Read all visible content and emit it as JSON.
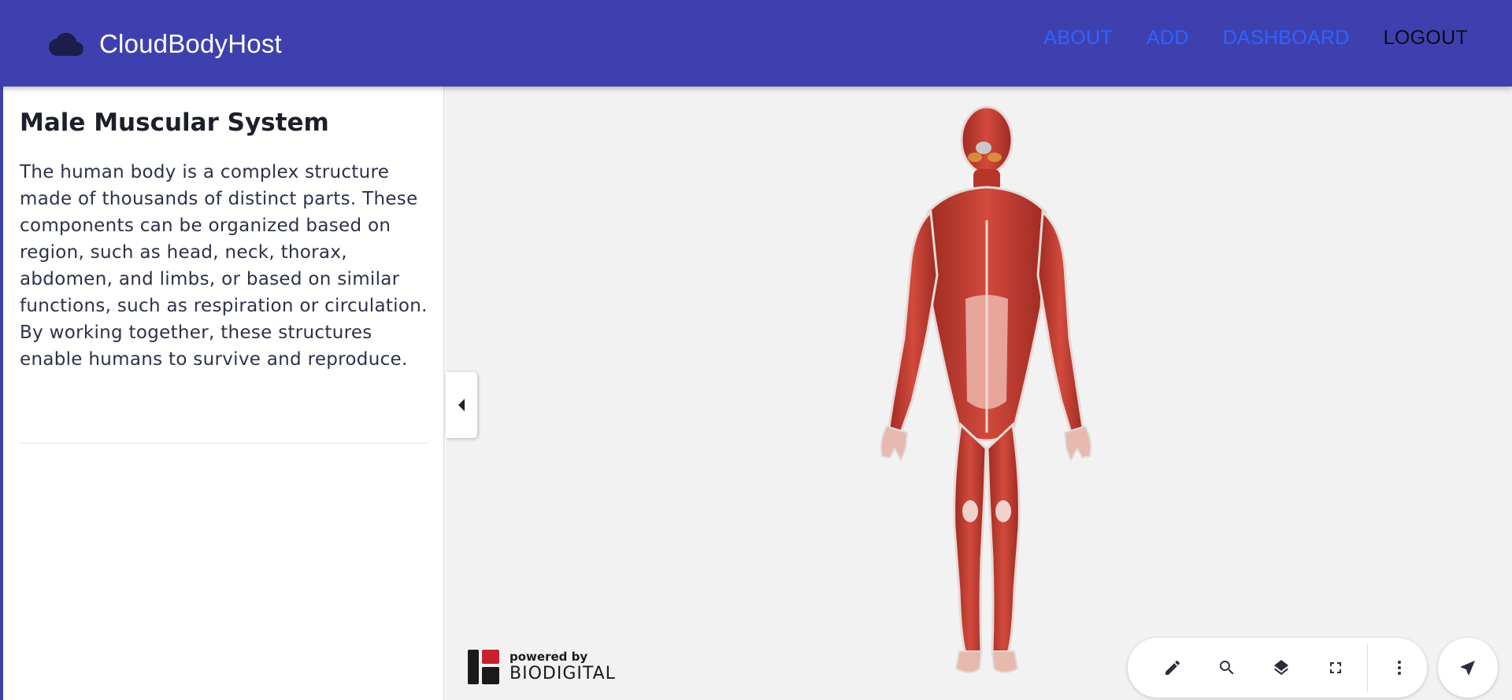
{
  "header": {
    "brand_name": "CloudBodyHost",
    "brand_icon": "cloud-icon",
    "nav": [
      {
        "label": "ABOUT"
      },
      {
        "label": "ADD"
      },
      {
        "label": "DASHBOARD"
      },
      {
        "label": "LOGOUT"
      }
    ]
  },
  "sidebar": {
    "title": "Male Muscular System",
    "description": "The human body is a complex structure made of thousands of distinct parts. These components can be organized based on region, such as head, neck, thorax, abdomen, and limbs, or based on similar functions, such as respiration or circulation. By working together, these structures enable humans to survive and reproduce.",
    "collapse_icon": "caret-left-icon"
  },
  "viewer": {
    "powered_by": "powered by",
    "powered_brand": "BIODIGITAL",
    "tools": [
      "pencil-icon",
      "search-icon",
      "layers-icon",
      "fullscreen-icon",
      "more-vert-icon"
    ],
    "nav_icon": "navigation-arrow-icon"
  },
  "colors": {
    "header_bg": "#3f40af",
    "nav_link": "#2f62ff",
    "nav_logout": "#0b0b14",
    "viewer_bg": "#f2f2f2",
    "muscle": "#c43d32"
  }
}
